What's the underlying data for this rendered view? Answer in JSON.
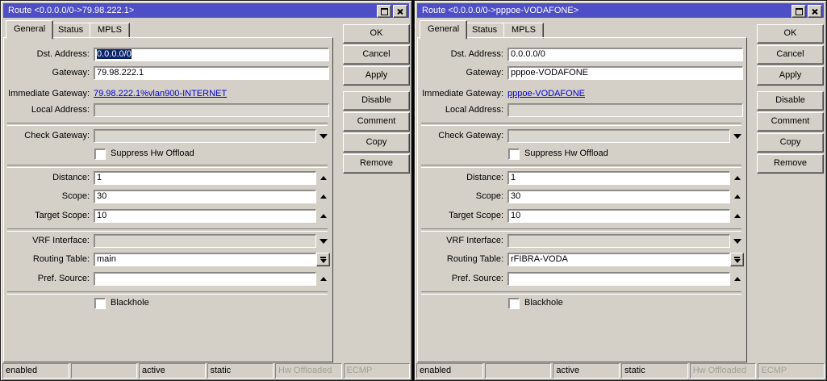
{
  "colors": {
    "titlebar": "#4e4ec6",
    "dialog_bg": "#d4d0c8",
    "link": "#0000d4",
    "selection_bg": "#0a246a",
    "disabled_text": "#a3a096"
  },
  "windows": [
    {
      "title": "Route <0.0.0.0/0->79.98.222.1>",
      "tabs": [
        "General",
        "Status",
        "MPLS"
      ],
      "fields": {
        "dst_address_label": "Dst. Address:",
        "dst_address_value": "0.0.0.0/0",
        "gateway_label": "Gateway:",
        "gateway_value": "79.98.222.1",
        "immediate_gateway_label": "Immediate Gateway:",
        "immediate_gateway_value": "79.98.222.1%vlan900-INTERNET",
        "local_address_label": "Local Address:",
        "local_address_value": "",
        "check_gateway_label": "Check Gateway:",
        "check_gateway_value": "",
        "suppress_hw_offload_label": "Suppress Hw Offload",
        "distance_label": "Distance:",
        "distance_value": "1",
        "scope_label": "Scope:",
        "scope_value": "30",
        "target_scope_label": "Target Scope:",
        "target_scope_value": "10",
        "vrf_interface_label": "VRF Interface:",
        "vrf_interface_value": "",
        "routing_table_label": "Routing Table:",
        "routing_table_value": "main",
        "pref_source_label": "Pref. Source:",
        "pref_source_value": "",
        "blackhole_label": "Blackhole"
      },
      "buttons": {
        "ok": "OK",
        "cancel": "Cancel",
        "apply": "Apply",
        "disable": "Disable",
        "comment": "Comment",
        "copy": "Copy",
        "remove": "Remove"
      },
      "status_bar": [
        "enabled",
        "",
        "active",
        "static",
        "Hw Offloaded",
        "ECMP"
      ]
    },
    {
      "title": "Route <0.0.0.0/0->pppoe-VODAFONE>",
      "tabs": [
        "General",
        "Status",
        "MPLS"
      ],
      "fields": {
        "dst_address_label": "Dst. Address:",
        "dst_address_value": "0.0.0.0/0",
        "gateway_label": "Gateway:",
        "gateway_value": "pppoe-VODAFONE",
        "immediate_gateway_label": "Immediate Gateway:",
        "immediate_gateway_value": "pppoe-VODAFONE",
        "local_address_label": "Local Address:",
        "local_address_value": "",
        "check_gateway_label": "Check Gateway:",
        "check_gateway_value": "",
        "suppress_hw_offload_label": "Suppress Hw Offload",
        "distance_label": "Distance:",
        "distance_value": "1",
        "scope_label": "Scope:",
        "scope_value": "30",
        "target_scope_label": "Target Scope:",
        "target_scope_value": "10",
        "vrf_interface_label": "VRF Interface:",
        "vrf_interface_value": "",
        "routing_table_label": "Routing Table:",
        "routing_table_value": "rFIBRA-VODA",
        "pref_source_label": "Pref. Source:",
        "pref_source_value": "",
        "blackhole_label": "Blackhole"
      },
      "buttons": {
        "ok": "OK",
        "cancel": "Cancel",
        "apply": "Apply",
        "disable": "Disable",
        "comment": "Comment",
        "copy": "Copy",
        "remove": "Remove"
      },
      "status_bar": [
        "enabled",
        "",
        "active",
        "static",
        "Hw Offloaded",
        "ECMP"
      ]
    }
  ]
}
